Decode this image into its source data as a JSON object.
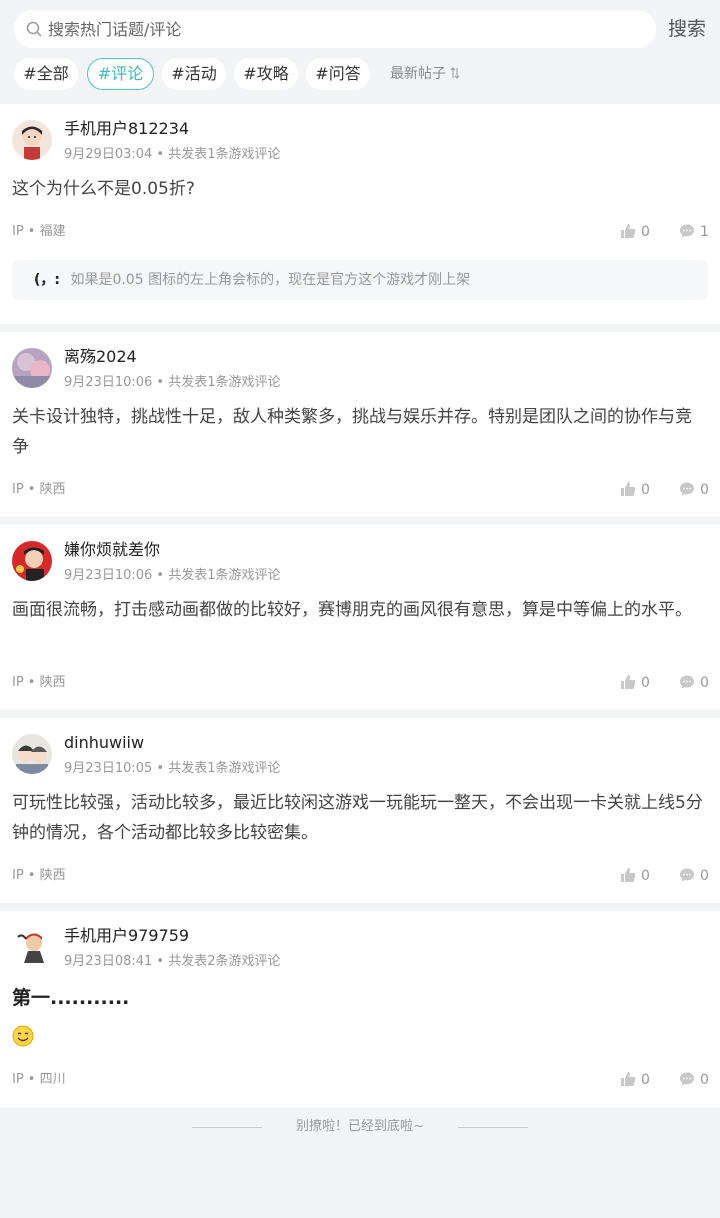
{
  "search": {
    "placeholder": "搜索热门话题/评论",
    "value": "",
    "button_label": "搜索"
  },
  "tabs": [
    {
      "label": "#全部",
      "active": false
    },
    {
      "label": "#评论",
      "active": true
    },
    {
      "label": "#活动",
      "active": false
    },
    {
      "label": "#攻略",
      "active": false
    },
    {
      "label": "#问答",
      "active": false
    }
  ],
  "sort": {
    "label": "最新帖子",
    "icon": "sort-arrows-icon"
  },
  "posts": [
    {
      "username": "手机用户812234",
      "time": "9月29日03:04",
      "meta_suffix": "• 共发表1条游戏评论",
      "content": "这个为什么不是0.05折?",
      "ip": "IP • 福建",
      "likes": "0",
      "comments": "1",
      "reply": {
        "author": "(，:",
        "text": "如果是0.05 图标的左上角会标的，现在是官方这个游戏才刚上架"
      }
    },
    {
      "username": "离殇2024",
      "time": "9月23日10:06",
      "meta_suffix": "• 共发表1条游戏评论",
      "content": "关卡设计独特，挑战性十足，敌人种类繁多，挑战与娱乐并存。特别是团队之间的协作与竞争",
      "ip": "IP • 陕西",
      "likes": "0",
      "comments": "0"
    },
    {
      "username": "嫌你烦就差你",
      "time": "9月23日10:06",
      "meta_suffix": "• 共发表1条游戏评论",
      "content": "画面很流畅，打击感动画都做的比较好，赛博朋克的画风很有意思，算是中等偏上的水平。",
      "ip": "IP • 陕西",
      "likes": "0",
      "comments": "0"
    },
    {
      "username": "dinhuwiiw",
      "time": "9月23日10:05",
      "meta_suffix": "• 共发表1条游戏评论",
      "content": "可玩性比较强，活动比较多，最近比较闲这游戏一玩能玩一整天，不会出现一卡关就上线5分钟的情况，各个活动都比较多比较密集。",
      "ip": "IP • 陕西",
      "likes": "0",
      "comments": "0"
    },
    {
      "username": "手机用户979759",
      "time": "9月23日08:41",
      "meta_suffix": "• 共发表2条游戏评论",
      "content": "第一...........",
      "emoji": "smiling-face-emoji",
      "ip": "IP • 四川",
      "likes": "0",
      "comments": "0"
    }
  ],
  "footer": {
    "text": "别撩啦！已经到底啦~"
  },
  "colors": {
    "accent": "#3bb9bb",
    "background": "#f3f4f6",
    "card": "#ffffff",
    "muted": "#999999"
  }
}
